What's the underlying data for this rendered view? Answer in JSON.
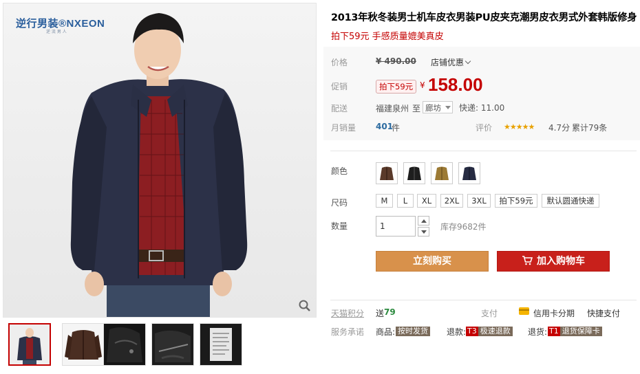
{
  "gallery": {
    "brand_name": "逆行男装®NXEON",
    "brand_tagline": "逆 流 男 人",
    "thumbnails": [
      {
        "alt": "jacket-front-model",
        "active": true
      },
      {
        "alt": "jacket-brown-flat"
      },
      {
        "alt": "jacket-leather-detail"
      },
      {
        "alt": "jacket-zipper-detail"
      },
      {
        "alt": "jacket-care-label"
      }
    ]
  },
  "product": {
    "title": "2013年秋冬装男士机车皮衣男装PU皮夹克潮男皮衣男式外套韩版修身",
    "subtitle": "拍下59元 手感质量媲美真皮"
  },
  "pricing": {
    "price_label": "价格",
    "original_price": "¥ 490.00",
    "store_discount": "店铺优惠",
    "promo_label": "促销",
    "promo_badge": "拍下59元",
    "currency": "¥",
    "promo_price": "158.00"
  },
  "shipping": {
    "label": "配送",
    "origin": "福建泉州",
    "to": "至",
    "destination": "廊坊",
    "express": "快递: 11.00"
  },
  "sales": {
    "label": "月销量",
    "count": "401",
    "unit": "件",
    "rating_label": "评价",
    "stars": "★★★★★",
    "score": "4.7分",
    "reviews": "累计79条"
  },
  "options": {
    "color_label": "颜色",
    "colors": [
      "brown",
      "black",
      "khaki",
      "navy"
    ],
    "size_label": "尺码",
    "sizes": [
      "M",
      "L",
      "XL",
      "2XL",
      "3XL",
      "拍下59元",
      "默认圆通快递"
    ],
    "qty_label": "数量",
    "qty_value": "1",
    "stock": "库存9682件"
  },
  "actions": {
    "buy_now": "立刻购买",
    "add_to_cart": "加入购物车"
  },
  "footer": {
    "points_label": "天猫积分",
    "points_prefix": "送",
    "points_value": "79",
    "pay_label": "支付",
    "credit": "信用卡分期",
    "quick_pay": "快捷支付",
    "service_label": "服务承诺",
    "goods_label": "商品:",
    "goods_tag": "按时发货",
    "refund_label": "退款:",
    "refund_code": "T3",
    "refund_tag": "极速退款",
    "return_label": "退货:",
    "return_code": "T1",
    "return_tag": "退货保障卡"
  },
  "colors": {
    "accent_red": "#c40000",
    "buy_orange": "#d8914b",
    "cart_red": "#c8201b"
  }
}
